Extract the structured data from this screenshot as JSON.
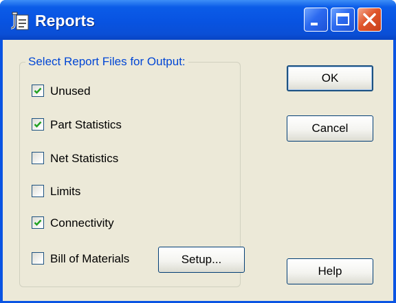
{
  "window": {
    "title": "Reports"
  },
  "group": {
    "title": "Select Report Files for Output:"
  },
  "checkboxes": [
    {
      "label": "Unused",
      "checked": true
    },
    {
      "label": "Part Statistics",
      "checked": true
    },
    {
      "label": "Net Statistics",
      "checked": false
    },
    {
      "label": "Limits",
      "checked": false
    },
    {
      "label": "Connectivity",
      "checked": true
    },
    {
      "label": "Bill of Materials",
      "checked": false
    }
  ],
  "buttons": {
    "ok": "OK",
    "cancel": "Cancel",
    "setup": "Setup...",
    "help": "Help"
  },
  "icons": {
    "app": "application-icon",
    "minimize": "minimize-icon",
    "maximize": "maximize-icon",
    "close": "close-icon"
  },
  "colors": {
    "titlebar": "#0853e1",
    "group_title": "#0046d5",
    "check": "#21a121",
    "close": "#e0562b"
  }
}
